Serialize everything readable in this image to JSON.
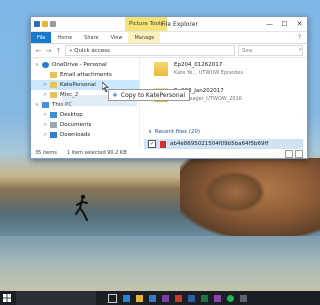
{
  "window": {
    "contextual_tab": "Picture Tools",
    "title": "File Explorer",
    "controls": {
      "minimize": "—",
      "maximize": "☐",
      "close": "✕"
    },
    "ribbon_tabs": [
      "File",
      "Home",
      "Share",
      "View",
      "Manage"
    ],
    "help": "?",
    "address": "« Quick access",
    "search_placeholder": "Sea",
    "nav_items": [
      {
        "label": "OneDrive - Personal",
        "level": 0,
        "expander": "∨"
      },
      {
        "label": "Email attachments",
        "level": 1
      },
      {
        "label": "KatePersonal",
        "level": 1,
        "expander": ">",
        "selected": true
      },
      {
        "label": "Misc_2",
        "level": 1,
        "expander": ">"
      },
      {
        "label": "This PC",
        "level": 0,
        "expander": "∨"
      },
      {
        "label": "Desktop",
        "level": 1,
        "expander": ">"
      },
      {
        "label": "Documents",
        "level": 1,
        "expander": ">"
      },
      {
        "label": "Downloads",
        "level": 1,
        "expander": ">"
      }
    ],
    "files": [
      {
        "name": "Ep204_01262017",
        "sub": "Kate Ye... UTWOW Episodes"
      },
      {
        "name": "Ep203_Jan202017",
        "sub": "Kate Yeager_UTWOW_2016"
      }
    ],
    "recent_header": "Recent files (20)",
    "recent_row": {
      "check": "✓",
      "name": "ab4e8695021504f09b5ba64f5b69ff"
    },
    "status": {
      "items": "35 items",
      "selection": "1 item selected  90.2 KB"
    }
  },
  "drag_tooltip": {
    "plus": "+",
    "label": "Copy to KatePersonal"
  },
  "colors": {
    "accent": "#1979ca",
    "selection": "#cce8ff",
    "contextual": "#f5e37a"
  }
}
